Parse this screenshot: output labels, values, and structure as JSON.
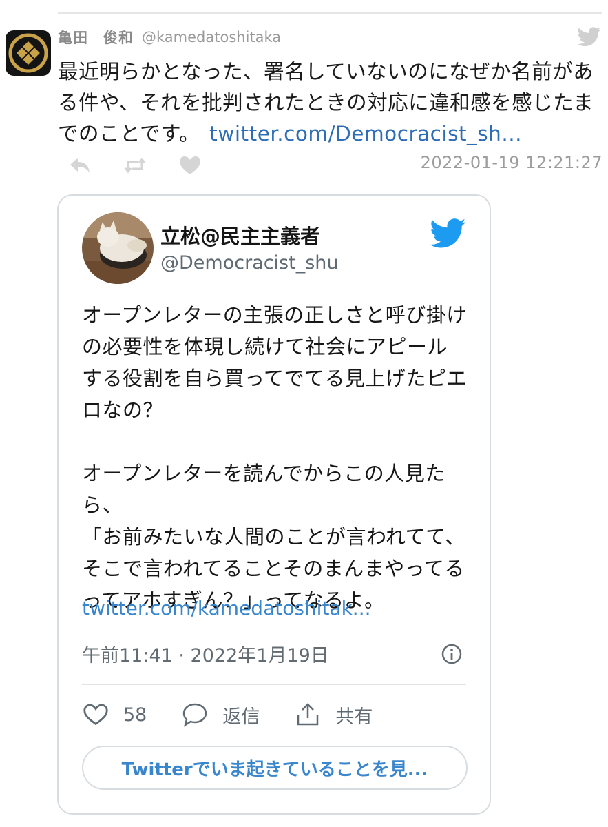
{
  "tweet": {
    "author_name": "亀田　俊和",
    "author_handle": "@kamedatoshitaka",
    "text": "最近明らかとなった、署名していないのになぜか名前がある件や、それを批判されたときの対応に違和感を感じたまでのことです。",
    "link": "twitter.com/Democracist_sh...",
    "timestamp": "2022-01-19 12:21:27",
    "icons": {
      "reply": "reply-icon",
      "retweet": "retweet-icon",
      "like": "heart-icon",
      "brand": "twitter-bird-icon"
    }
  },
  "quoted": {
    "name": "立松@民主主義者",
    "handle": "@Democracist_shu",
    "body": "オープンレターの主張の正しさと呼び掛けの必要性を体現し続けて社会にアピールする役割を自ら買ってでてる見上げたピエロなの？\n\nオープンレターを読んでからこの人見たら、\n「お前みたいな人間のことが言われてて、そこで言われてることそのまんまやってるってアホすぎん？」ってなるよ。",
    "link": "twitter.com/kamedatoshitak...",
    "date": "午前11:41 · 2022年1月19日",
    "likes": "58",
    "reply_label": "返信",
    "share_label": "共有",
    "cta": "Twitterでいま起きていることを見..."
  },
  "colors": {
    "twitter_blue": "#1d9bf0",
    "link_dark": "#2e6db5",
    "link_light": "#3a86cc",
    "muted": "#9a9a9a"
  }
}
